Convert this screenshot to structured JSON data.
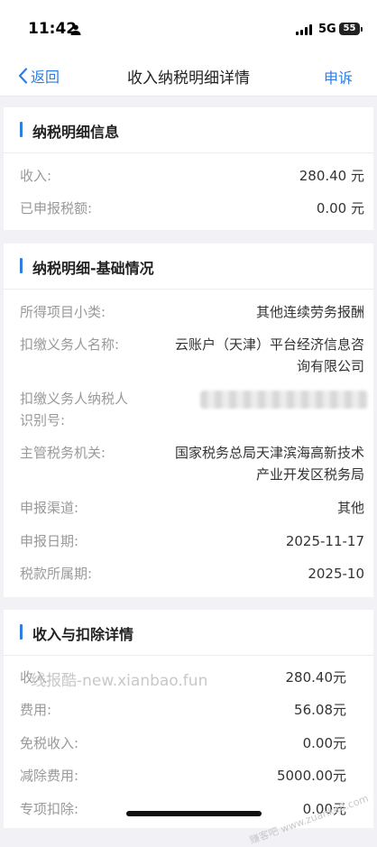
{
  "status": {
    "time": "11:42",
    "network": "5G",
    "battery": "55"
  },
  "nav": {
    "back_label": "返回",
    "title": "收入纳税明细详情",
    "appeal_label": "申诉"
  },
  "section1": {
    "title": "纳税明细信息",
    "rows": [
      {
        "label": "收入:",
        "value": "280.40 元"
      },
      {
        "label": "已申报税额:",
        "value": "0.00 元"
      }
    ]
  },
  "section2": {
    "title": "纳税明细-基础情况",
    "rows": [
      {
        "label": "所得项目小类:",
        "value": "其他连续劳务报酬"
      },
      {
        "label": "扣缴义务人名称:",
        "value_line1": "云账户（天津）平台经济信息咨",
        "value_line2": "询有限公司"
      },
      {
        "label_line1": "扣缴义务人纳税人",
        "label_line2": "识别号:"
      },
      {
        "label": "主管税务机关:",
        "value_line1": "国家税务总局天津滨海高新技术",
        "value_line2": "产业开发区税务局"
      },
      {
        "label": "申报渠道:",
        "value": "其他"
      },
      {
        "label": "申报日期:",
        "value": "2025-11-17"
      },
      {
        "label": "税款所属期:",
        "value": "2025-10"
      }
    ]
  },
  "section3": {
    "title": "收入与扣除详情",
    "rows": [
      {
        "label": "收入:",
        "value": "280.40元"
      },
      {
        "label": "费用:",
        "value": "56.08元"
      },
      {
        "label": "免税收入:",
        "value": "0.00元"
      },
      {
        "label": "减除费用:",
        "value": "5000.00元"
      },
      {
        "label": "专项扣除:",
        "value": "0.00元"
      }
    ]
  },
  "watermark": {
    "text": "线报酷-new.xianbao.fun",
    "stamp": "赚客吧 www.zuanke8.com"
  }
}
